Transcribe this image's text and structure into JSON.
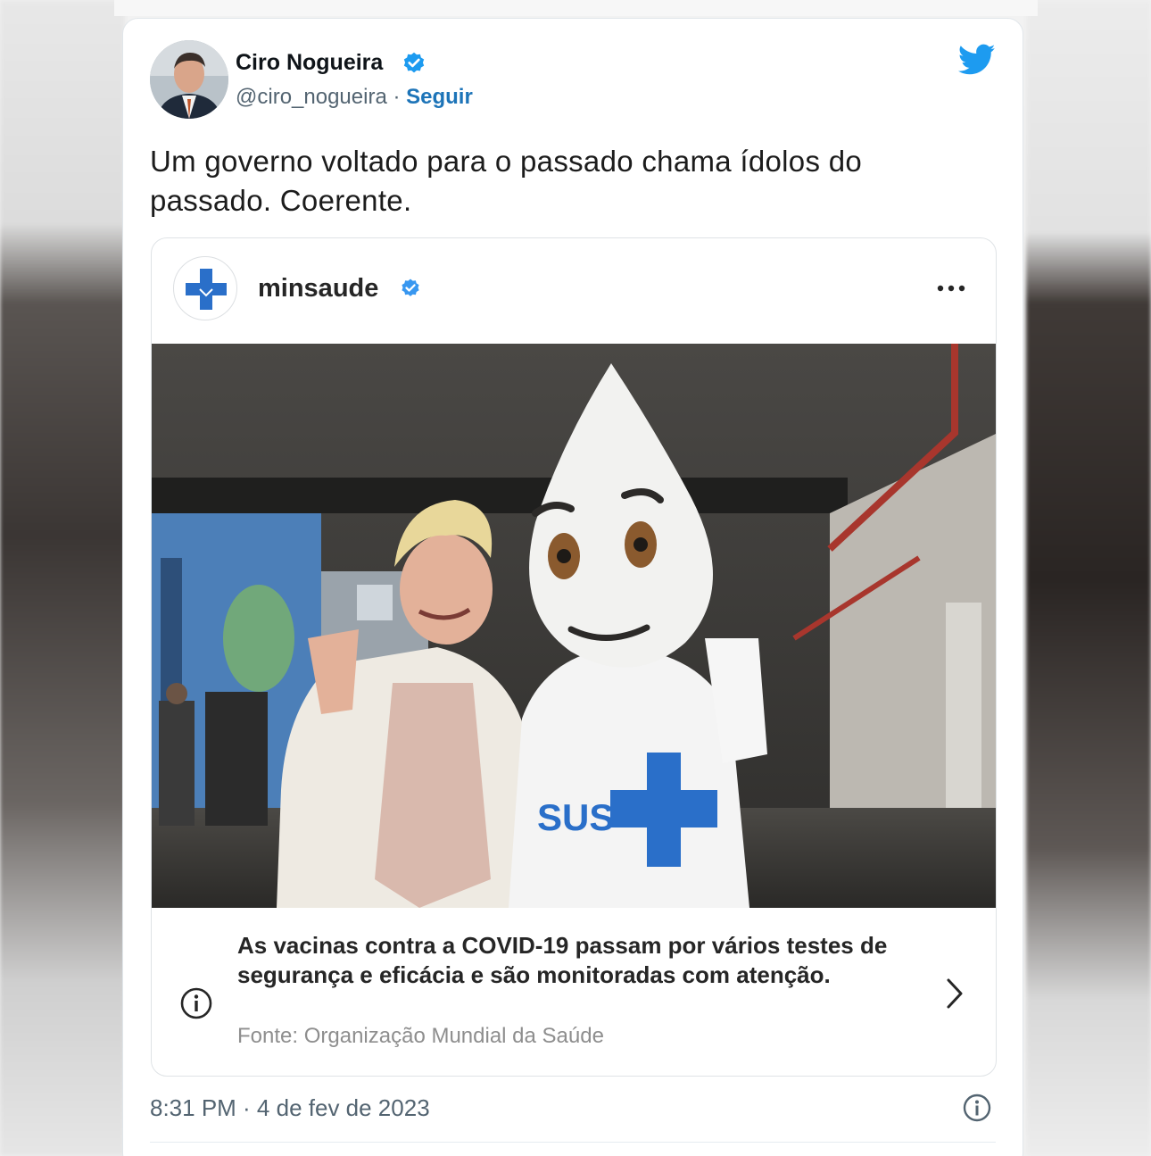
{
  "tweet": {
    "author_name": "Ciro Nogueira",
    "handle": "@ciro_nogueira",
    "separator": " · ",
    "follow_label": "Seguir",
    "text": "Um governo voltado para o passado chama ídolos do passado. Coerente.",
    "timestamp": "8:31 PM · 4 de fev de 2023",
    "icons": {
      "verified": "verified-badge-icon",
      "brand": "twitter-bird-icon",
      "info": "info-circle-icon"
    },
    "colors": {
      "brand_blue": "#1d9bf0",
      "follow_link": "#1d74b8"
    }
  },
  "embedded_post": {
    "account_name": "minsaude",
    "avatar_icon": "health-cross-icon",
    "menu_icon": "more-dots-icon",
    "photo_sign_text": "SUS",
    "notice": {
      "text": "As vacinas contra a COVID-19 passam por vários testes de segurança e eficácia e são monitoradas com atenção.",
      "source": "Fonte: Organização Mundial da Saúde"
    },
    "colors": {
      "cross_blue": "#2a6fc9",
      "verified_blue": "#3897f0"
    }
  }
}
